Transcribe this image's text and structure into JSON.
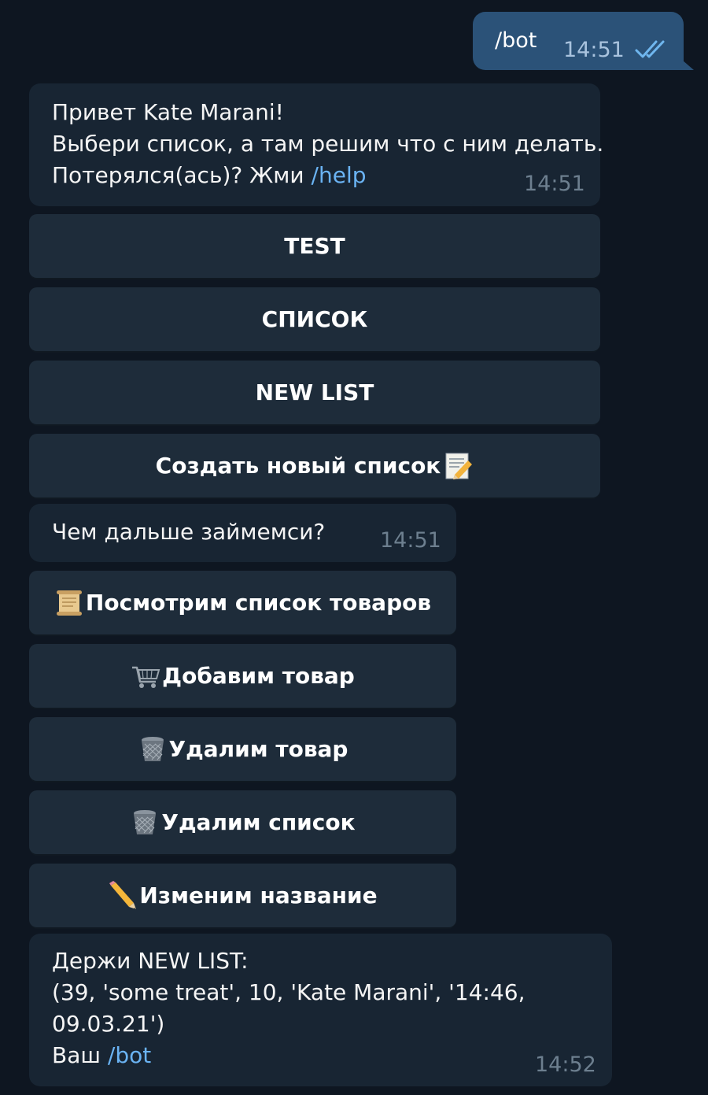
{
  "outgoing": {
    "text": "/bot",
    "time": "14:51",
    "status_icon": "double-check-icon"
  },
  "greeting": {
    "line1": "Привет Kate Marani!",
    "line2": "Выбери список, а там решим что с ним делать.",
    "line3_prefix": "Потерялся(ась)? Жми ",
    "line3_link": "/help",
    "time": "14:51"
  },
  "list_buttons": [
    {
      "label": "TEST"
    },
    {
      "label": "СПИСОК"
    },
    {
      "label": "NEW LIST"
    },
    {
      "label": "Создать новый список",
      "icon": "memo-pencil-icon"
    }
  ],
  "question": {
    "text": "Чем дальше займемси?",
    "time": "14:51"
  },
  "action_buttons": [
    {
      "label": "Посмотрим список товаров",
      "icon": "scroll-icon"
    },
    {
      "label": "Добавим товар",
      "icon": "shopping-cart-icon"
    },
    {
      "label": "Удалим товар",
      "icon": "wastebasket-icon"
    },
    {
      "label": "Удалим список",
      "icon": "wastebasket-icon"
    },
    {
      "label": "Изменим название",
      "icon": "pencil-icon"
    }
  ],
  "result": {
    "line1": "Держи NEW LIST:",
    "line2": "(39, 'some treat', 10, 'Kate Marani', '14:46,",
    "line3": "09.03.21')",
    "line4_prefix": "Ваш ",
    "line4_link": "/bot",
    "time": "14:52"
  },
  "colors": {
    "background": "#0e1621",
    "outgoing_bubble": "#2b5278",
    "incoming_bubble": "#182533",
    "button": "#1e2c3a",
    "link": "#6ab3f3"
  }
}
